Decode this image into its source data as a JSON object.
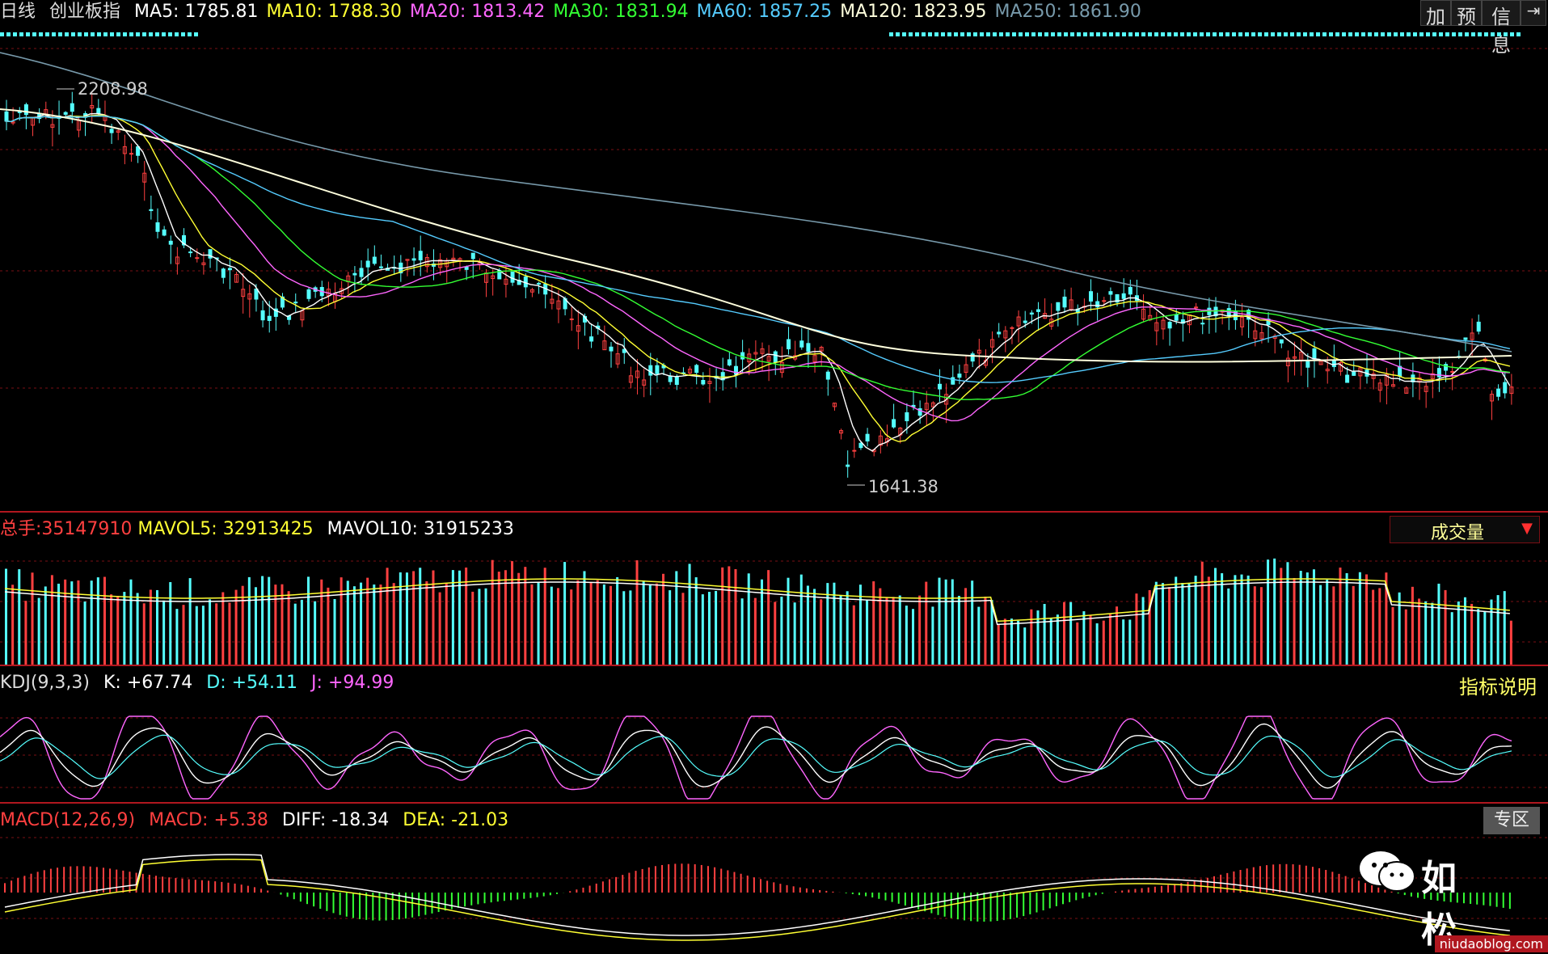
{
  "header": {
    "period": "日线",
    "index_name": "创业板指",
    "ma": [
      {
        "label": "MA5:",
        "value": "1785.81",
        "color": "#ffffff"
      },
      {
        "label": "MA10:",
        "value": "1788.30",
        "color": "#ffff33"
      },
      {
        "label": "MA20:",
        "value": "1813.42",
        "color": "#ff66ff"
      },
      {
        "label": "MA30:",
        "value": "1831.94",
        "color": "#33ff33"
      },
      {
        "label": "MA60:",
        "value": "1857.25",
        "color": "#55ccff"
      },
      {
        "label": "MA120:",
        "value": "1823.95",
        "color": "#ffffdd"
      },
      {
        "label": "MA250:",
        "value": "1861.90",
        "color": "#7799aa"
      }
    ],
    "right_buttons": [
      "加",
      "预",
      "信息",
      "→|"
    ]
  },
  "price_panel": {
    "high_label": "2208.98",
    "low_label": "1641.38"
  },
  "volume_panel": {
    "total_label": "总手:",
    "total_value": "35147910",
    "mavol5_label": "MAVOL5:",
    "mavol5_value": "32913425",
    "mavol10_label": "MAVOL10:",
    "mavol10_value": "31915233",
    "selector_label": "成交量"
  },
  "kdj_panel": {
    "name": "KDJ(9,3,3)",
    "k_label": "K:",
    "k_value": "+67.74",
    "d_label": "D:",
    "d_value": "+54.11",
    "j_label": "J:",
    "j_value": "+94.99",
    "help_label": "指标说明"
  },
  "macd_panel": {
    "name": "MACD(12,26,9)",
    "macd_label": "MACD:",
    "macd_value": "+5.38",
    "diff_label": "DIFF:",
    "diff_value": "-18.34",
    "dea_label": "DEA:",
    "dea_value": "-21.03",
    "zone_label": "专区"
  },
  "watermark": {
    "name": "如松",
    "site": "niudaoblog.com"
  },
  "colors": {
    "up": "#ff4040",
    "down": "#55ffff",
    "grid": "#7a0f14",
    "macd_pos": "#ff4040",
    "macd_neg": "#33ff33"
  }
}
